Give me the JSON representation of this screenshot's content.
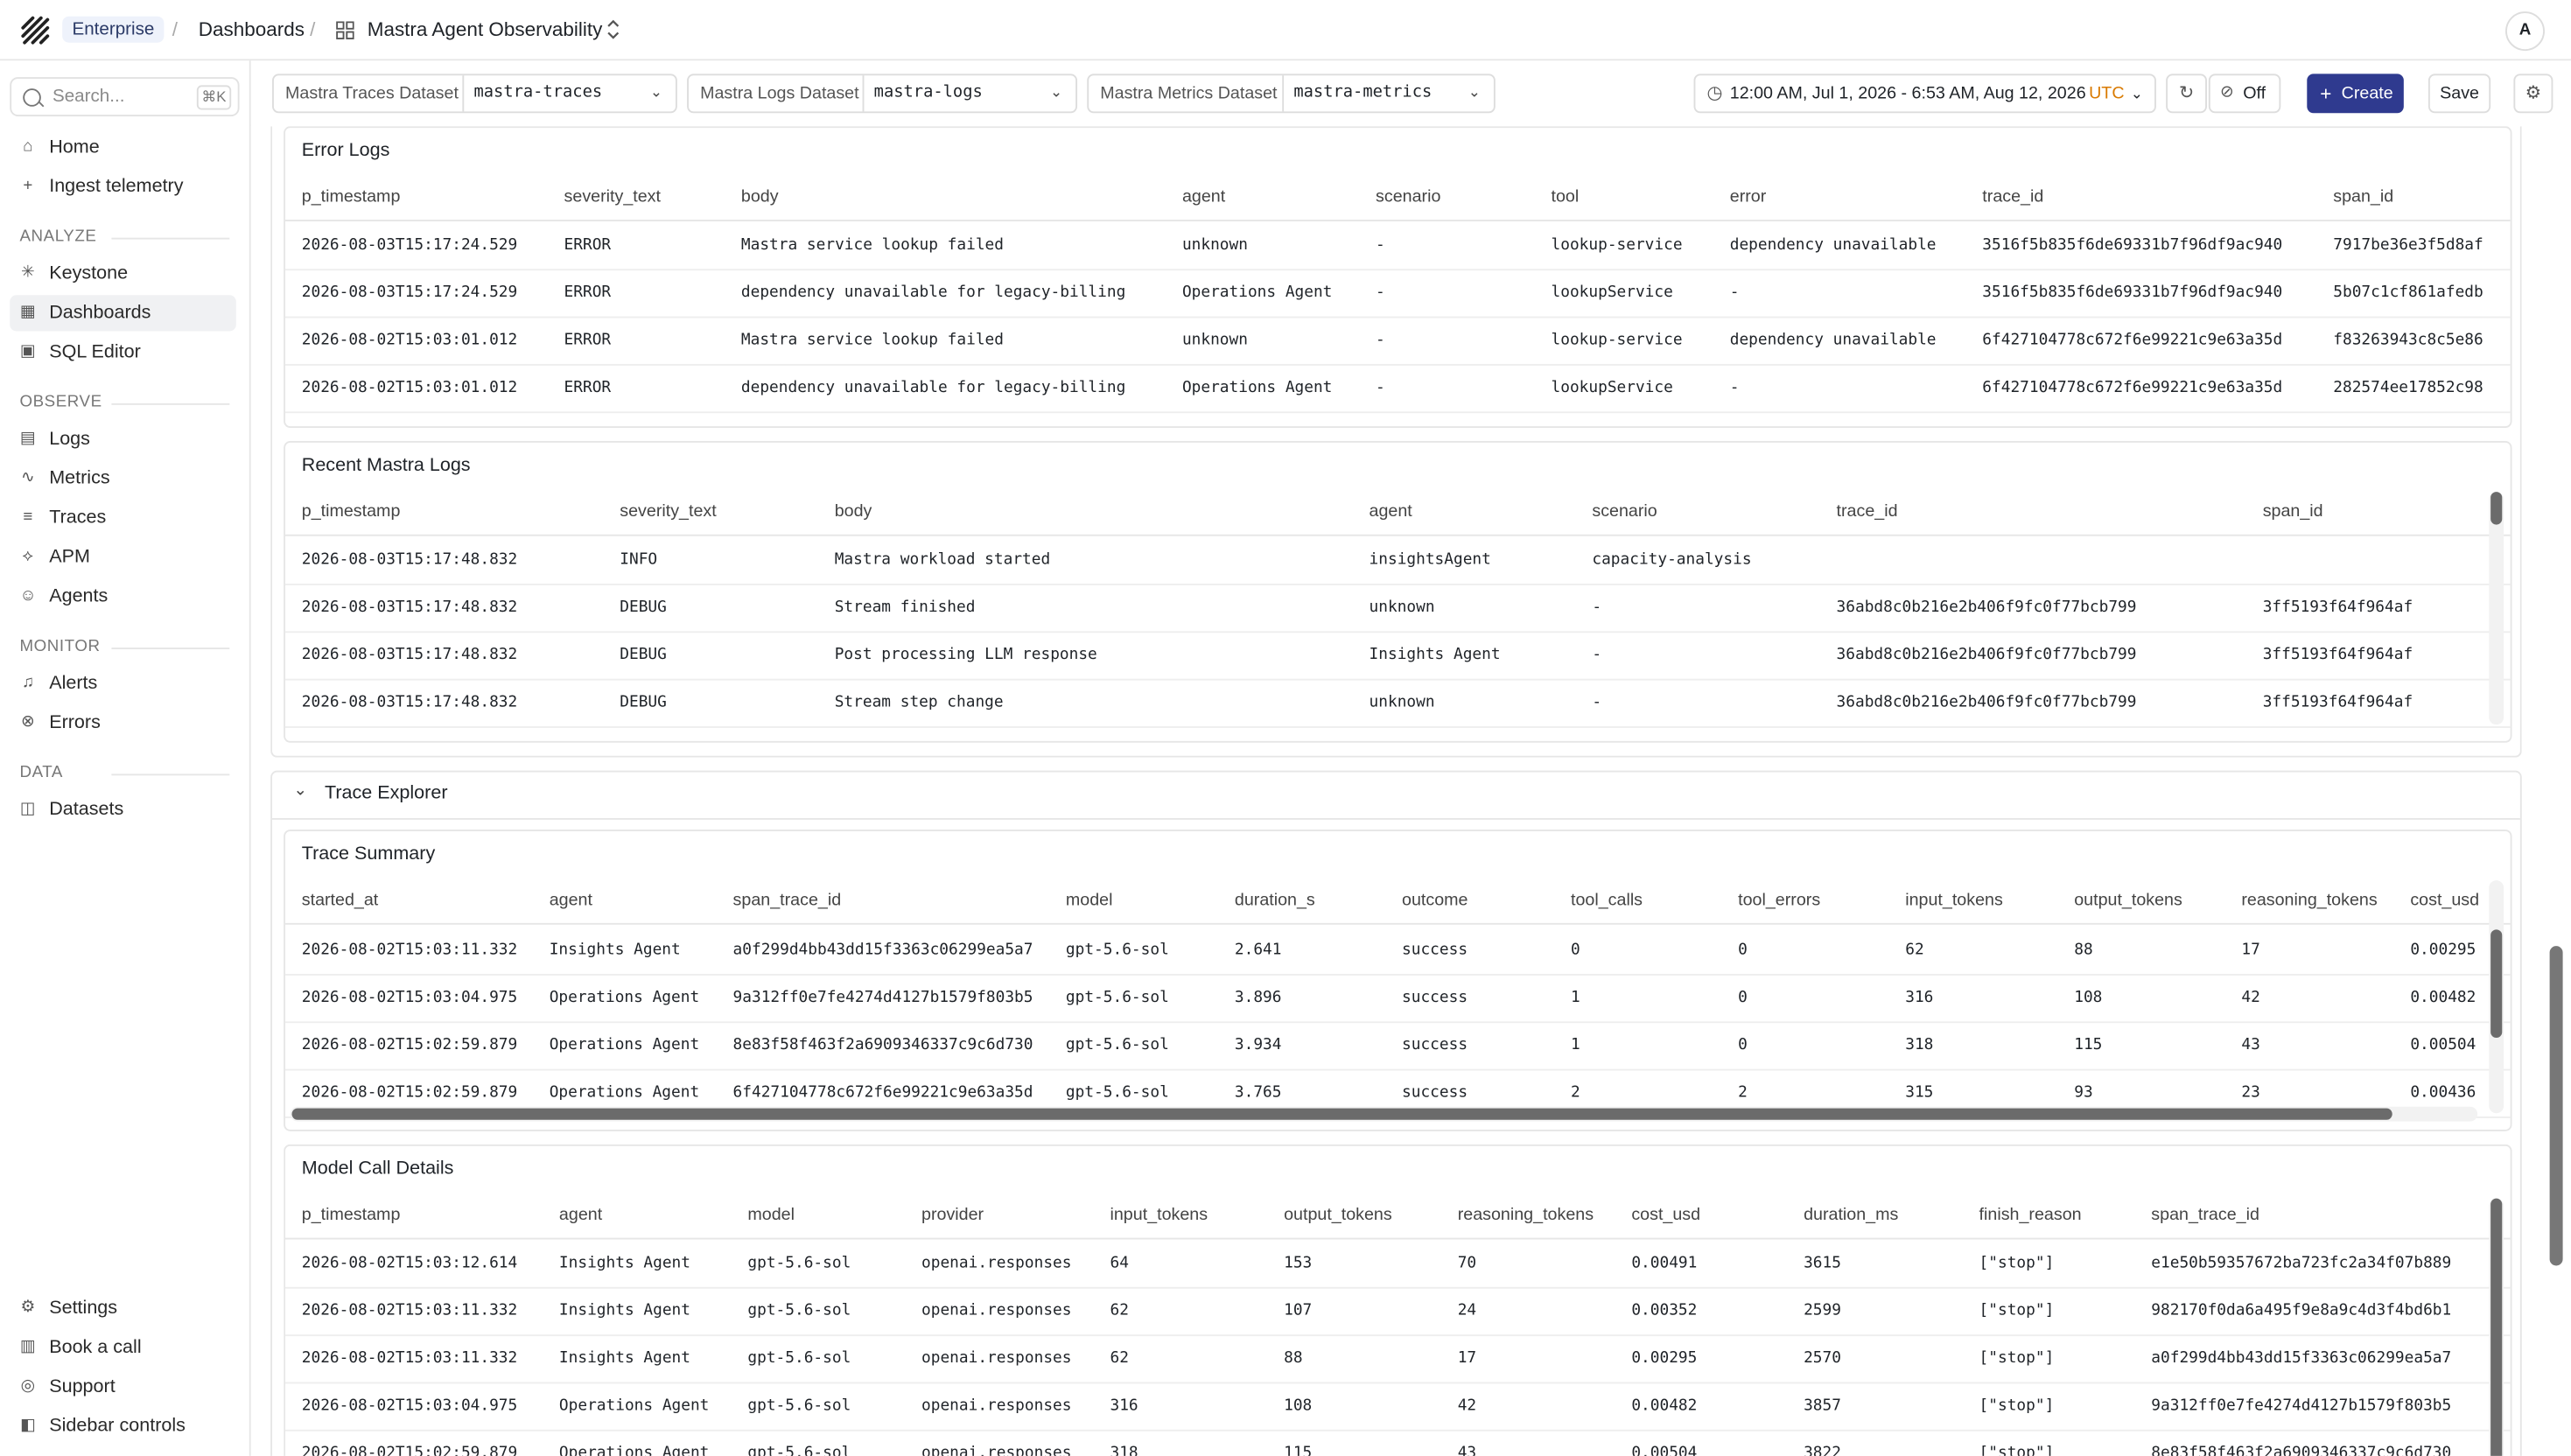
{
  "topbar": {
    "badge": "Enterprise",
    "crumb1": "Dashboards",
    "crumb2": "Mastra Agent Observability",
    "sep": "/",
    "avatar": "A"
  },
  "sidebar": {
    "search_placeholder": "Search...",
    "search_kbd": "⌘K",
    "top_items": [
      {
        "label": "Home",
        "icon": "home-icon"
      },
      {
        "label": "Ingest telemetry",
        "icon": "plus-icon"
      }
    ],
    "sections": {
      "analyze": "ANALYZE",
      "observe": "OBSERVE",
      "monitor": "MONITOR",
      "data": "DATA"
    },
    "analyze_items": [
      {
        "label": "Keystone"
      },
      {
        "label": "Dashboards"
      },
      {
        "label": "SQL Editor"
      }
    ],
    "observe_items": [
      {
        "label": "Logs"
      },
      {
        "label": "Metrics"
      },
      {
        "label": "Traces"
      },
      {
        "label": "APM"
      },
      {
        "label": "Agents"
      }
    ],
    "monitor_items": [
      {
        "label": "Alerts"
      },
      {
        "label": "Errors"
      }
    ],
    "data_items": [
      {
        "label": "Datasets"
      }
    ],
    "bottom_items": [
      {
        "label": "Settings"
      },
      {
        "label": "Book a call"
      },
      {
        "label": "Support"
      },
      {
        "label": "Sidebar controls"
      }
    ]
  },
  "filters": {
    "traces_label": "Mastra Traces Dataset",
    "traces_value": "mastra-traces",
    "logs_label": "Mastra Logs Dataset",
    "logs_value": "mastra-logs",
    "metrics_label": "Mastra Metrics Dataset",
    "metrics_value": "mastra-metrics",
    "time_range": "12:00 AM, Jul 1, 2026 - 6:53 AM, Aug 12, 2026",
    "timezone": "UTC",
    "refresh_off": "Off",
    "create": "Create",
    "save": "Save"
  },
  "error_logs": {
    "title": "Error Logs",
    "columns": [
      "p_timestamp",
      "severity_text",
      "body",
      "agent",
      "scenario",
      "tool",
      "error",
      "trace_id",
      "span_id"
    ],
    "rows": [
      [
        "2026-08-03T15:17:24.529",
        "ERROR",
        "Mastra service lookup failed",
        "unknown",
        "-",
        "lookup-service",
        "dependency unavailable",
        "3516f5b835f6de69331b7f96df9ac940",
        "7917be36e3f5d8af"
      ],
      [
        "2026-08-03T15:17:24.529",
        "ERROR",
        "dependency unavailable for legacy-billing",
        "Operations Agent",
        "-",
        "lookupService",
        "-",
        "3516f5b835f6de69331b7f96df9ac940",
        "5b07c1cf861afedb"
      ],
      [
        "2026-08-02T15:03:01.012",
        "ERROR",
        "Mastra service lookup failed",
        "unknown",
        "-",
        "lookup-service",
        "dependency unavailable",
        "6f427104778c672f6e99221c9e63a35d",
        "f83263943c8c5e86"
      ],
      [
        "2026-08-02T15:03:01.012",
        "ERROR",
        "dependency unavailable for legacy-billing",
        "Operations Agent",
        "-",
        "lookupService",
        "-",
        "6f427104778c672f6e99221c9e63a35d",
        "282574ee17852c98"
      ]
    ]
  },
  "recent_logs": {
    "title": "Recent Mastra Logs",
    "columns": [
      "p_timestamp",
      "severity_text",
      "body",
      "agent",
      "scenario",
      "trace_id",
      "span_id"
    ],
    "rows": [
      [
        "2026-08-03T15:17:48.832",
        "INFO",
        "Mastra workload started",
        "insightsAgent",
        "capacity-analysis",
        "",
        ""
      ],
      [
        "2026-08-03T15:17:48.832",
        "DEBUG",
        "Stream finished",
        "unknown",
        "-",
        "36abd8c0b216e2b406f9fc0f77bcb799",
        "3ff5193f64f964af"
      ],
      [
        "2026-08-03T15:17:48.832",
        "DEBUG",
        "Post processing LLM response",
        "Insights Agent",
        "-",
        "36abd8c0b216e2b406f9fc0f77bcb799",
        "3ff5193f64f964af"
      ],
      [
        "2026-08-03T15:17:48.832",
        "DEBUG",
        "Stream step change",
        "unknown",
        "-",
        "36abd8c0b216e2b406f9fc0f77bcb799",
        "3ff5193f64f964af"
      ]
    ]
  },
  "trace_explorer": {
    "title": "Trace Explorer"
  },
  "trace_summary": {
    "title": "Trace Summary",
    "columns": [
      "started_at",
      "agent",
      "span_trace_id",
      "model",
      "duration_s",
      "outcome",
      "tool_calls",
      "tool_errors",
      "input_tokens",
      "output_tokens",
      "reasoning_tokens",
      "cost_usd"
    ],
    "rows": [
      [
        "2026-08-02T15:03:11.332",
        "Insights Agent",
        "a0f299d4bb43dd15f3363c06299ea5a7",
        "gpt-5.6-sol",
        "2.641",
        "success",
        "0",
        "0",
        "62",
        "88",
        "17",
        "0.00295"
      ],
      [
        "2026-08-02T15:03:04.975",
        "Operations Agent",
        "9a312ff0e7fe4274d4127b1579f803b5",
        "gpt-5.6-sol",
        "3.896",
        "success",
        "1",
        "0",
        "316",
        "108",
        "42",
        "0.00482"
      ],
      [
        "2026-08-02T15:02:59.879",
        "Operations Agent",
        "8e83f58f463f2a6909346337c9c6d730",
        "gpt-5.6-sol",
        "3.934",
        "success",
        "1",
        "0",
        "318",
        "115",
        "43",
        "0.00504"
      ],
      [
        "2026-08-02T15:02:59.879",
        "Operations Agent",
        "6f427104778c672f6e99221c9e63a35d",
        "gpt-5.6-sol",
        "3.765",
        "success",
        "2",
        "2",
        "315",
        "93",
        "23",
        "0.00436"
      ]
    ]
  },
  "model_calls": {
    "title": "Model Call Details",
    "columns": [
      "p_timestamp",
      "agent",
      "model",
      "provider",
      "input_tokens",
      "output_tokens",
      "reasoning_tokens",
      "cost_usd",
      "duration_ms",
      "finish_reason",
      "span_trace_id"
    ],
    "rows": [
      [
        "2026-08-02T15:03:12.614",
        "Insights Agent",
        "gpt-5.6-sol",
        "openai.responses",
        "64",
        "153",
        "70",
        "0.00491",
        "3615",
        "[\"stop\"]",
        "e1e50b59357672ba723fc2a34f07b889"
      ],
      [
        "2026-08-02T15:03:11.332",
        "Insights Agent",
        "gpt-5.6-sol",
        "openai.responses",
        "62",
        "107",
        "24",
        "0.00352",
        "2599",
        "[\"stop\"]",
        "982170f0da6a495f9e8a9c4d3f4bd6b1"
      ],
      [
        "2026-08-02T15:03:11.332",
        "Insights Agent",
        "gpt-5.6-sol",
        "openai.responses",
        "62",
        "88",
        "17",
        "0.00295",
        "2570",
        "[\"stop\"]",
        "a0f299d4bb43dd15f3363c06299ea5a7"
      ],
      [
        "2026-08-02T15:03:04.975",
        "Operations Agent",
        "gpt-5.6-sol",
        "openai.responses",
        "316",
        "108",
        "42",
        "0.00482",
        "3857",
        "[\"stop\"]",
        "9a312ff0e7fe4274d4127b1579f803b5"
      ],
      [
        "2026-08-02T15:02:59.879",
        "Operations Agent",
        "gpt-5.6-sol",
        "openai.responses",
        "318",
        "115",
        "43",
        "0.00504",
        "3822",
        "[\"stop\"]",
        "8e83f58f463f2a6909346337c9c6d730"
      ]
    ]
  }
}
